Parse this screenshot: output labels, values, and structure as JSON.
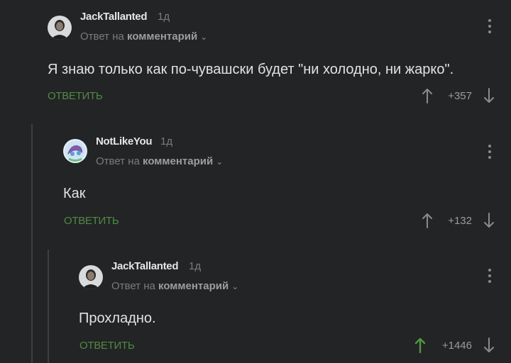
{
  "comments": [
    {
      "author": "JackTallanted",
      "time": "1д",
      "reply_prefix": "Ответ на",
      "reply_target": "комментарий",
      "text": "Я знаю только как по-чувашски будет \"ни холодно, ни жарко\".",
      "reply_label": "ОТВЕТИТЬ",
      "score": "+357"
    },
    {
      "author": "NotLikeYou",
      "time": "1д",
      "reply_prefix": "Ответ на",
      "reply_target": "комментарий",
      "text": "Как",
      "reply_label": "ОТВЕТИТЬ",
      "score": "+132"
    },
    {
      "author": "JackTallanted",
      "time": "1д",
      "reply_prefix": "Ответ на",
      "reply_target": "комментарий",
      "text": "Прохладно.",
      "reply_label": "ОТВЕТИТЬ",
      "score": "+1446",
      "upvoted": true
    }
  ],
  "colors": {
    "background": "#232425",
    "reply_green": "#4f8a45",
    "upvote_active": "#4f9a3f",
    "muted": "#7b7c7e"
  }
}
